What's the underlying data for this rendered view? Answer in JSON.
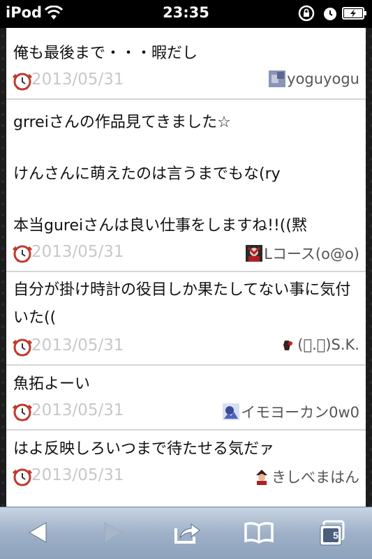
{
  "status_bar": {
    "carrier": "iPod",
    "time": "23:35"
  },
  "entries": [
    {
      "message": "俺も最後まで・・・暇だし",
      "date": "2013/05/31",
      "user": "yoguyogu"
    },
    {
      "message": "grreiさんの作品見てきました☆\n\nけんさんに萌えたのは言うまでもな(ry\n\n本当gureiさんは良い仕事をしますね!!((黙",
      "date": "2013/05/31",
      "user": "Lコース(o@o)"
    },
    {
      "message": "自分が掛け時計の役目しか果たしてない事に気付いた((",
      "date": "2013/05/31",
      "user": "(ﾟ.ﾟ)S.K."
    },
    {
      "message": "魚拓よーい",
      "date": "2013/05/31",
      "user": "イモヨーカン0w0"
    },
    {
      "message": "はよ反映しろいつまで待たせる気だァ",
      "date": "2013/05/31",
      "user": "きしべまはん"
    }
  ],
  "toolbar": {
    "tabs_count": "5",
    "back_icon": "back-arrow-icon",
    "forward_icon": "forward-arrow-icon",
    "share_icon": "share-icon",
    "bookmarks_icon": "bookmarks-book-icon",
    "tabs_icon": "tabs-icon"
  },
  "colors": {
    "date_text": "#c8c8c8",
    "toolbar": "#9fb1c8",
    "separator": "#d6d6d6"
  }
}
